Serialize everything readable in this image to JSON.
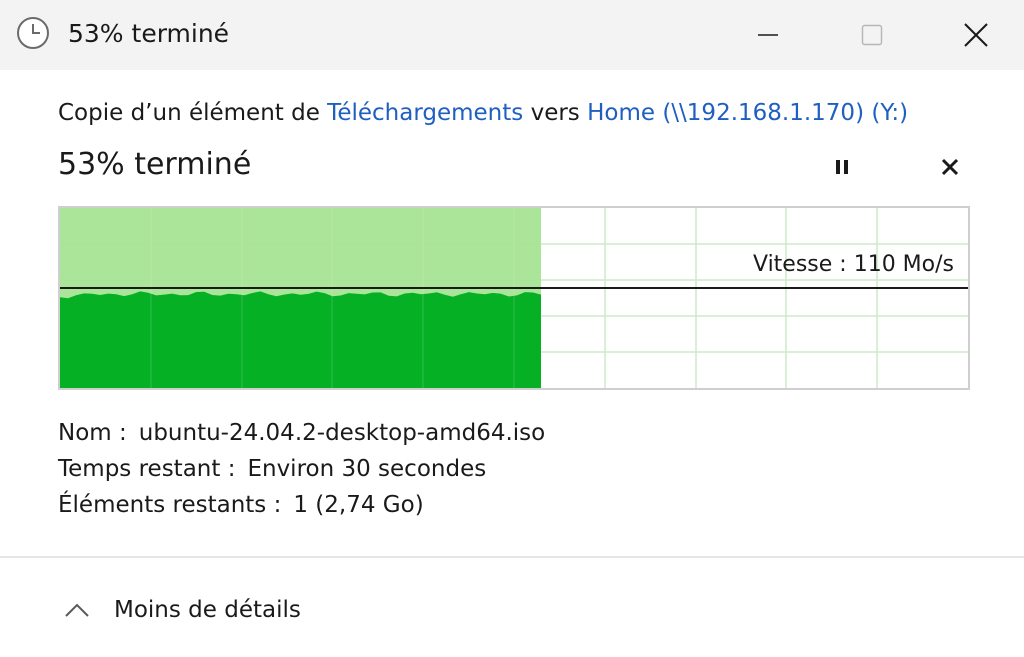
{
  "window": {
    "title": "53% terminé",
    "controls": {
      "minimize": "minimize-icon",
      "maximize": "maximize-icon",
      "close": "close-icon"
    }
  },
  "operation": {
    "prefix": "Copie d’un élément de ",
    "source": "Téléchargements",
    "middle": " vers ",
    "destination": "Home (\\\\192.168.1.170) (Y:)",
    "percent_text": "53% terminé",
    "progress": 0.53
  },
  "graph": {
    "speed_label": "Vitesse : 110 Mo/s",
    "fill_color": "#06b025",
    "background_fill_color": "#a6e495",
    "grid_color": "#cdebc8"
  },
  "details": {
    "name_label": "Nom :",
    "name_value": "ubuntu-24.04.2-desktop-amd64.iso",
    "time_label": "Temps restant :",
    "time_value": "Environ 30 secondes",
    "items_label": "Éléments restants :",
    "items_value": "1 (2,74 Go)"
  },
  "footer": {
    "toggle_label": "Moins de détails"
  },
  "colors": {
    "link": "#1f5fbf",
    "titlebar_bg": "#f3f3f3"
  }
}
